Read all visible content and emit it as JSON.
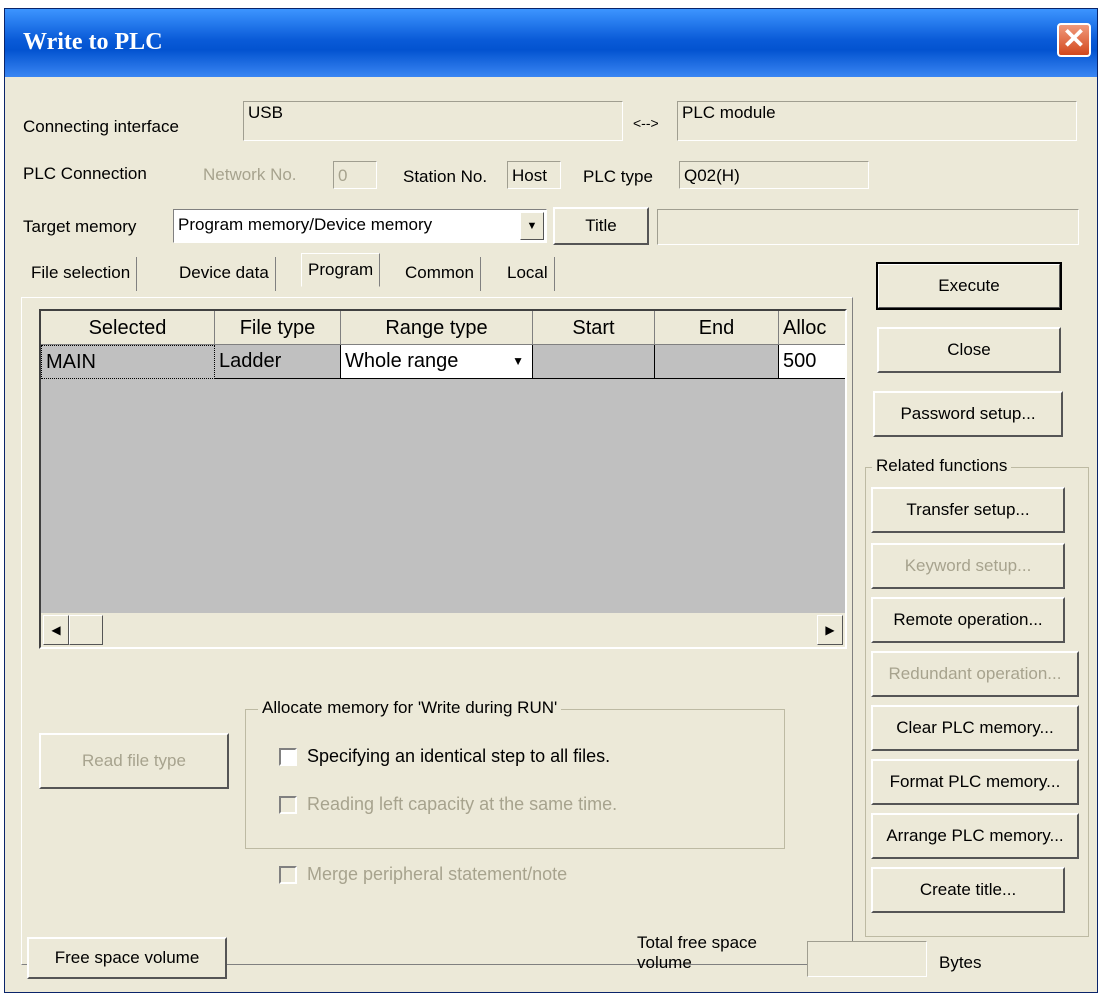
{
  "window": {
    "title": "Write to PLC"
  },
  "connection": {
    "interface_label": "Connecting interface",
    "interface_value": "USB",
    "arrow": "<-->",
    "module_value": "PLC module",
    "plc_connection_label": "PLC Connection",
    "network_label": "Network No.",
    "network_value": "0",
    "station_label": "Station No.",
    "station_value": "Host",
    "plc_type_label": "PLC type",
    "plc_type_value": "Q02(H)"
  },
  "memory": {
    "target_label": "Target memory",
    "target_value": "Program memory/Device memory",
    "title_button": "Title",
    "title_value": ""
  },
  "tabs": [
    "File selection",
    "Device data",
    "Program",
    "Common",
    "Local"
  ],
  "active_tab": "Program",
  "table": {
    "headers": [
      "Selected",
      "File type",
      "Range type",
      "Start",
      "End",
      "Alloc"
    ],
    "rows": [
      {
        "selected": "MAIN",
        "file_type": "Ladder",
        "range_type": "Whole range",
        "start": "",
        "end": "",
        "alloc": "500"
      }
    ]
  },
  "buttons": {
    "read_file_type": "Read file type",
    "free_space_volume": "Free space volume",
    "execute": "Execute",
    "close": "Close",
    "password_setup": "Password setup..."
  },
  "allocate": {
    "title": "Allocate memory for 'Write during RUN'",
    "identical_step": "Specifying an identical step to all files.",
    "reading_left": "Reading left capacity at the same time.",
    "merge": "Merge peripheral statement/note"
  },
  "related": {
    "title": "Related functions",
    "transfer_setup": "Transfer setup...",
    "keyword_setup": "Keyword setup...",
    "remote_operation": "Remote operation...",
    "redundant_operation": "Redundant operation...",
    "clear_memory": "Clear PLC memory...",
    "format_memory": "Format PLC memory...",
    "arrange_memory": "Arrange PLC memory...",
    "create_title": "Create title..."
  },
  "footer": {
    "total_free_label": "Total free space volume",
    "total_free_value": "",
    "bytes_label": "Bytes"
  }
}
